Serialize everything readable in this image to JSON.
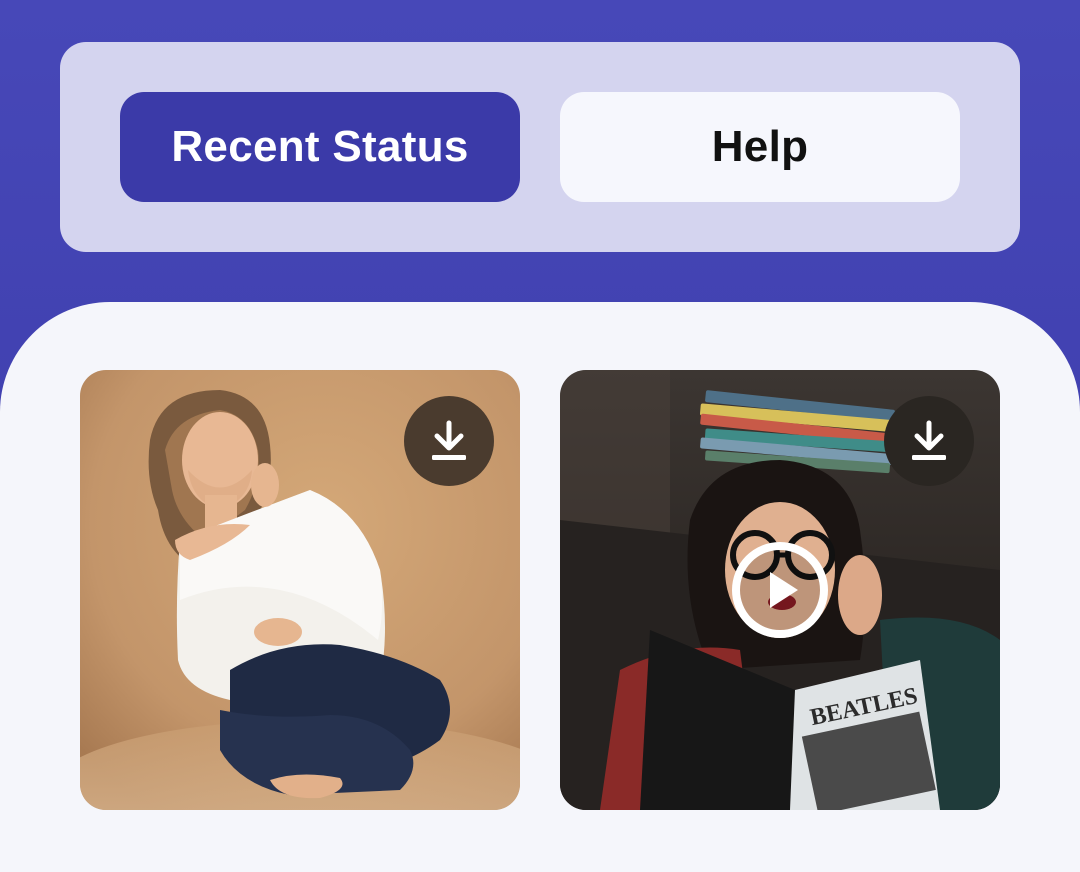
{
  "tabs": {
    "recent_status": "Recent Status",
    "help": "Help"
  },
  "media": [
    {
      "type": "image",
      "subject": "woman in white sweater sitting",
      "action_icon": "download-icon"
    },
    {
      "type": "video",
      "subject": "woman reading book with books on head",
      "book_title": "BEATLES",
      "action_icon": "download-icon",
      "overlay_icon": "play-icon"
    }
  ],
  "colors": {
    "header_bg": "#4748b8",
    "tab_panel_bg": "#d4d4ef",
    "active_tab": "#3b3aa8",
    "inactive_tab": "#f6f7fd",
    "content_bg": "#f5f6fb"
  }
}
